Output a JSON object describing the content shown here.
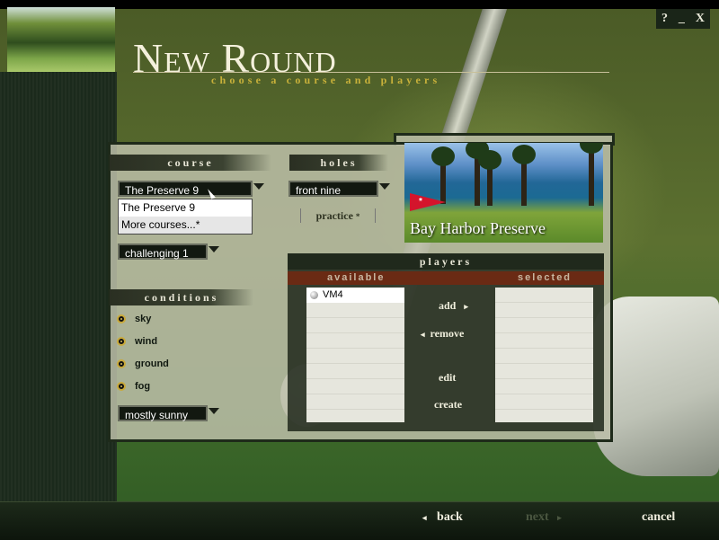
{
  "window": {
    "controls": [
      "?",
      "_",
      "X"
    ]
  },
  "header": {
    "title": "New Round",
    "subtitle": "choose a course and players"
  },
  "course_section": {
    "header": "course",
    "selected": "The Preserve 9",
    "dropdown_options": [
      "The Preserve 9",
      "More courses...*"
    ],
    "difficulty": "challenging 1"
  },
  "holes_section": {
    "header": "holes",
    "selected": "front nine",
    "practice_label": "practice",
    "practice_marker": "*"
  },
  "course_preview": {
    "name": "Bay Harbor Preserve",
    "flag_marker": "*"
  },
  "conditions_section": {
    "header": "conditions",
    "options": [
      "sky",
      "wind",
      "ground",
      "fog"
    ],
    "value": "mostly sunny"
  },
  "players_section": {
    "header": "players",
    "available_header": "available",
    "selected_header": "selected",
    "available": [
      "VM4"
    ],
    "selected": [],
    "add_label": "add",
    "remove_label": "remove",
    "edit_label": "edit",
    "create_label": "create"
  },
  "footer": {
    "back_label": "back",
    "next_label": "next",
    "cancel_label": "cancel"
  },
  "colors": {
    "accent_gold": "#c8b13a",
    "panel_bg": "#bcbea8",
    "header_red": "#6a2a14"
  }
}
